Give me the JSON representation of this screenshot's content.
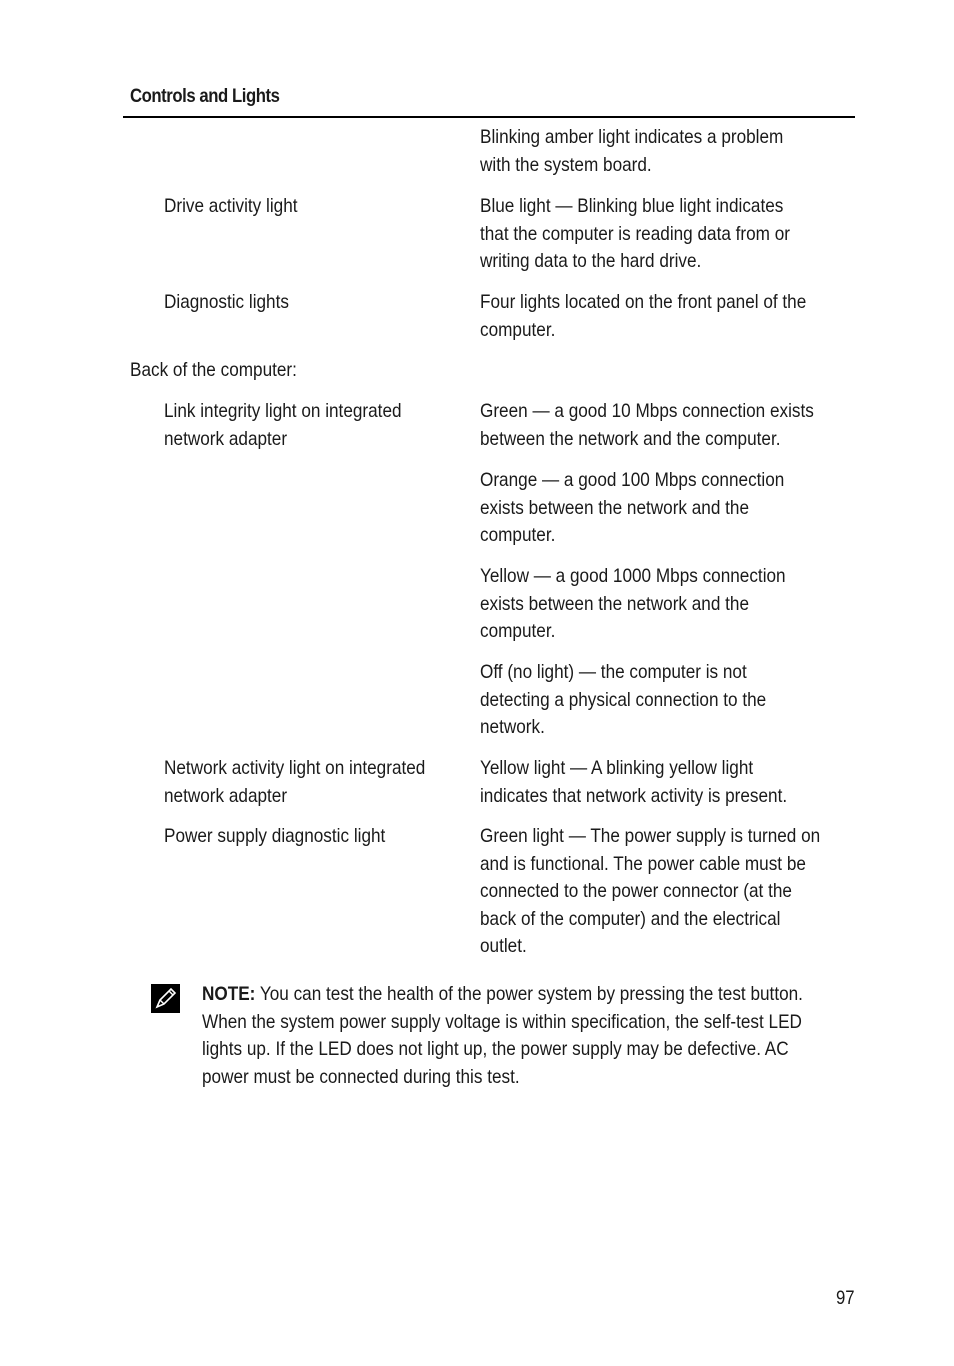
{
  "header": {
    "title": "Controls and Lights"
  },
  "rows": [
    {
      "label": "",
      "desc": [
        "Blinking amber light indicates a problem",
        "with the system board."
      ]
    },
    {
      "label": "Drive activity light",
      "desc": [
        "Blue light — Blinking blue light indicates",
        "that the computer is reading data from or",
        "writing data to the hard drive."
      ]
    },
    {
      "label": "Diagnostic lights",
      "desc": [
        "Four lights located on the front panel of the",
        "computer."
      ]
    }
  ],
  "section": {
    "title": "Back of the computer:"
  },
  "back_rows": [
    {
      "label": [
        "Link integrity light on integrated",
        "network adapter"
      ],
      "descs": [
        [
          "Green — a good 10 Mbps connection exists",
          "between the network and the computer."
        ],
        [
          "Orange — a good 100 Mbps connection",
          "exists between the network and the",
          "computer."
        ],
        [
          "Yellow — a good 1000 Mbps connection",
          "exists between the network and the",
          "computer."
        ],
        [
          "Off (no light) — the computer is not",
          "detecting a physical connection to the",
          "network."
        ]
      ]
    },
    {
      "label": [
        "Network activity light on integrated",
        "network adapter"
      ],
      "descs": [
        [
          "Yellow light — A blinking yellow light",
          "indicates that network activity is present."
        ]
      ]
    },
    {
      "label": [
        "Power supply diagnostic light"
      ],
      "descs": [
        [
          "Green light — The power supply is turned on",
          "and is functional. The power cable must be",
          "connected to the power connector (at the",
          "back of the computer) and the electrical",
          "outlet."
        ]
      ]
    }
  ],
  "note": {
    "icon": "pencil-note-icon",
    "label": "NOTE:",
    "lines": [
      " You can test the health of the power system by pressing the test button.",
      "When the system power supply voltage is within specification, the self-test LED",
      "lights up. If the LED does not light up, the power supply may be defective. AC",
      "power must be connected during this test."
    ]
  },
  "footer": {
    "page_number": "97"
  }
}
